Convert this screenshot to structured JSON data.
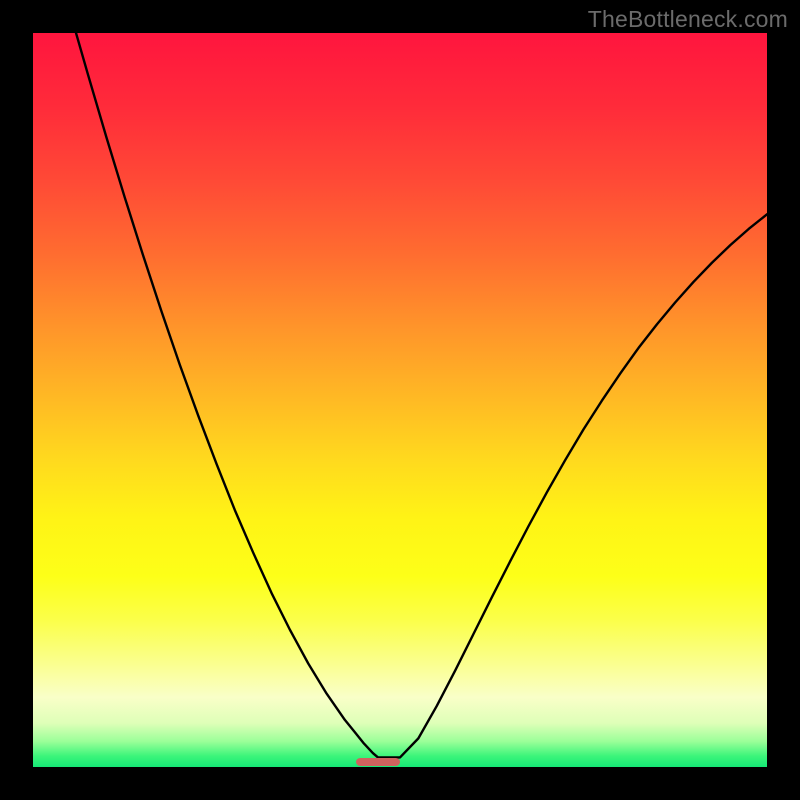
{
  "watermark": "TheBottleneck.com",
  "colors": {
    "black": "#000000",
    "curve": "#000000",
    "marker": "#cf625e",
    "grad_stops": [
      {
        "offset": 0.0,
        "color": "#ff153e"
      },
      {
        "offset": 0.1,
        "color": "#ff2b3a"
      },
      {
        "offset": 0.2,
        "color": "#ff4936"
      },
      {
        "offset": 0.3,
        "color": "#ff6c30"
      },
      {
        "offset": 0.4,
        "color": "#ff942a"
      },
      {
        "offset": 0.5,
        "color": "#ffba24"
      },
      {
        "offset": 0.58,
        "color": "#ffd91e"
      },
      {
        "offset": 0.66,
        "color": "#fff316"
      },
      {
        "offset": 0.74,
        "color": "#fdff18"
      },
      {
        "offset": 0.8,
        "color": "#fbff4a"
      },
      {
        "offset": 0.86,
        "color": "#faff90"
      },
      {
        "offset": 0.905,
        "color": "#f9ffc8"
      },
      {
        "offset": 0.94,
        "color": "#dfffb8"
      },
      {
        "offset": 0.965,
        "color": "#9bff99"
      },
      {
        "offset": 0.985,
        "color": "#3cf57a"
      },
      {
        "offset": 1.0,
        "color": "#15e876"
      }
    ]
  },
  "chart_data": {
    "type": "line",
    "title": "",
    "xlabel": "",
    "ylabel": "",
    "xlim": [
      0,
      1
    ],
    "ylim": [
      0,
      1
    ],
    "x": [
      0.0,
      0.025,
      0.05,
      0.075,
      0.1,
      0.125,
      0.15,
      0.175,
      0.2,
      0.225,
      0.25,
      0.275,
      0.3,
      0.325,
      0.35,
      0.375,
      0.4,
      0.425,
      0.438,
      0.45,
      0.463,
      0.47,
      0.5,
      0.525,
      0.55,
      0.575,
      0.6,
      0.625,
      0.65,
      0.675,
      0.7,
      0.725,
      0.75,
      0.775,
      0.8,
      0.825,
      0.85,
      0.875,
      0.9,
      0.925,
      0.95,
      0.975,
      1.0
    ],
    "y": [
      1.21,
      1.12,
      1.03,
      0.943,
      0.858,
      0.776,
      0.697,
      0.621,
      0.548,
      0.479,
      0.413,
      0.35,
      0.292,
      0.237,
      0.187,
      0.141,
      0.1,
      0.064,
      0.048,
      0.033,
      0.019,
      0.013,
      0.013,
      0.039,
      0.083,
      0.131,
      0.181,
      0.231,
      0.28,
      0.328,
      0.374,
      0.418,
      0.46,
      0.499,
      0.536,
      0.571,
      0.603,
      0.633,
      0.661,
      0.687,
      0.711,
      0.733,
      0.753
    ],
    "vertex_x": 0.47,
    "marker": {
      "x0": 0.44,
      "x1": 0.5,
      "y": 0.0045,
      "rx": 0.006
    }
  }
}
